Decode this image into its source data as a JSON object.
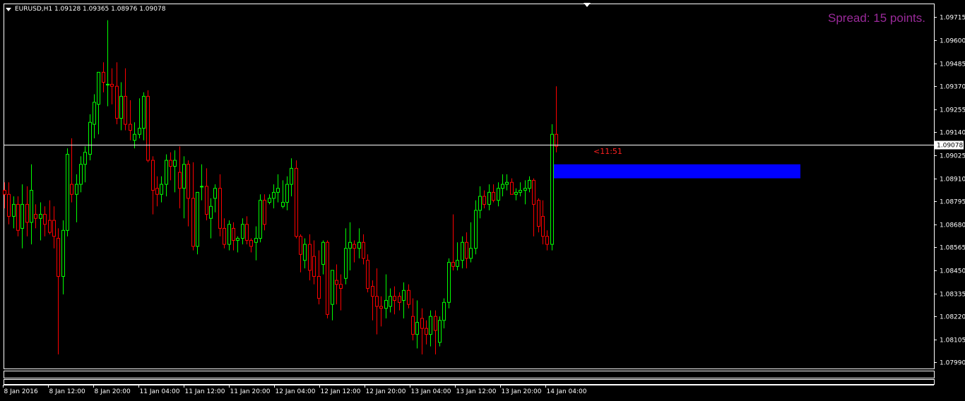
{
  "header": {
    "title": "EURUSD,H1  1.09128 1.09365 1.08976 1.09078",
    "spread": "Spread: 15 points.",
    "countdown": "<11:51"
  },
  "colors": {
    "background": "#000000",
    "bull": "#00ff00",
    "bear": "#ff0000",
    "grid_frame": "#ffffff",
    "axis_text": "#ffffff",
    "spread_text": "#9a2a9a",
    "zone": "#0000ff",
    "current_price_line": "#ffffff"
  },
  "chart_data": {
    "type": "candlestick",
    "symbol": "EURUSD",
    "timeframe": "H1",
    "ylim": [
      1.0794,
      1.0977
    ],
    "yticks": [
      "1.09715",
      "1.09600",
      "1.09485",
      "1.09370",
      "1.09255",
      "1.09140",
      "1.09025",
      "1.08910",
      "1.08795",
      "1.08680",
      "1.08565",
      "1.08450",
      "1.08335",
      "1.08220",
      "1.08105",
      "1.07990"
    ],
    "xticks": [
      "8 Jan 2016",
      "8 Jan 12:00",
      "8 Jan 20:00",
      "11 Jan 04:00",
      "11 Jan 12:00",
      "11 Jan 20:00",
      "12 Jan 04:00",
      "12 Jan 12:00",
      "12 Jan 20:00",
      "13 Jan 04:00",
      "13 Jan 12:00",
      "13 Jan 20:00",
      "14 Jan 04:00"
    ],
    "current_price": "1.09078",
    "zone": {
      "top": 1.0898,
      "bottom": 1.0891
    },
    "candles": [
      [
        1.0885,
        1.0889,
        1.0876,
        1.0883
      ],
      [
        1.0883,
        1.0889,
        1.0868,
        1.0872
      ],
      [
        1.0872,
        1.0882,
        1.0866,
        1.0878
      ],
      [
        1.0878,
        1.0882,
        1.0862,
        1.0865
      ],
      [
        1.0866,
        1.0888,
        1.0856,
        1.0878
      ],
      [
        1.0878,
        1.0887,
        1.0862,
        1.0869
      ],
      [
        1.0869,
        1.0898,
        1.0858,
        1.0885
      ],
      [
        1.0873,
        1.0878,
        1.0866,
        1.0871
      ],
      [
        1.0871,
        1.0879,
        1.086,
        1.0873
      ],
      [
        1.0873,
        1.0877,
        1.0862,
        1.0868
      ],
      [
        1.087,
        1.088,
        1.0863,
        1.0864
      ],
      [
        1.087,
        1.0877,
        1.0856,
        1.0862
      ],
      [
        1.0861,
        1.0866,
        1.0803,
        1.0842
      ],
      [
        1.0842,
        1.087,
        1.0833,
        1.0865
      ],
      [
        1.0865,
        1.0906,
        1.0862,
        1.0903
      ],
      [
        1.0888,
        1.0911,
        1.0879,
        1.0883
      ],
      [
        1.0883,
        1.0893,
        1.0869,
        1.0888
      ],
      [
        1.0888,
        1.0902,
        1.0884,
        1.0898
      ],
      [
        1.0898,
        1.0907,
        1.0889,
        1.0904
      ],
      [
        1.0903,
        1.0923,
        1.09,
        1.0919
      ],
      [
        1.0918,
        1.0933,
        1.0911,
        1.0929
      ],
      [
        1.0928,
        1.0943,
        1.0913,
        1.0944
      ],
      [
        1.0944,
        1.0949,
        1.0934,
        1.0939
      ],
      [
        1.0938,
        1.097,
        1.0927,
        1.0938
      ],
      [
        1.0938,
        1.0946,
        1.0928,
        1.0937
      ],
      [
        1.0937,
        1.0949,
        1.0918,
        1.0921
      ],
      [
        1.0921,
        1.0939,
        1.0915,
        1.0932
      ],
      [
        1.0932,
        1.0946,
        1.0915,
        1.0918
      ],
      [
        1.0918,
        1.093,
        1.091,
        1.0915
      ],
      [
        1.091,
        1.0919,
        1.0906,
        1.0913
      ],
      [
        1.0913,
        1.0931,
        1.0911,
        1.0916
      ],
      [
        1.0916,
        1.0934,
        1.091,
        1.0932
      ],
      [
        1.0932,
        1.0935,
        1.0899,
        1.09
      ],
      [
        1.09,
        1.0902,
        1.0873,
        1.0885
      ],
      [
        1.0886,
        1.0892,
        1.0877,
        1.0883
      ],
      [
        1.0883,
        1.0892,
        1.0879,
        1.0888
      ],
      [
        1.0888,
        1.0903,
        1.0882,
        1.09
      ],
      [
        1.09,
        1.0904,
        1.089,
        1.0897
      ],
      [
        1.0897,
        1.0905,
        1.0884,
        1.09
      ],
      [
        1.0894,
        1.0907,
        1.0876,
        1.0886
      ],
      [
        1.0886,
        1.0902,
        1.0871,
        1.0898
      ],
      [
        1.0898,
        1.09,
        1.0867,
        1.0881
      ],
      [
        1.0881,
        1.0899,
        1.0855,
        1.0857
      ],
      [
        1.0857,
        1.0884,
        1.0853,
        1.0884
      ],
      [
        1.0887,
        1.0898,
        1.088,
        1.0887
      ],
      [
        1.0887,
        1.0896,
        1.087,
        1.0873
      ],
      [
        1.0871,
        1.0881,
        1.0861,
        1.0877
      ],
      [
        1.0881,
        1.0888,
        1.0874,
        1.0886
      ],
      [
        1.0886,
        1.0893,
        1.0862,
        1.0866
      ],
      [
        1.0866,
        1.0871,
        1.0856,
        1.0858
      ],
      [
        1.0858,
        1.087,
        1.0855,
        1.0868
      ],
      [
        1.0866,
        1.0869,
        1.0855,
        1.086
      ],
      [
        1.086,
        1.0862,
        1.0854,
        1.0861
      ],
      [
        1.0861,
        1.0871,
        1.0858,
        1.0868
      ],
      [
        1.0868,
        1.0872,
        1.0858,
        1.086
      ],
      [
        1.086,
        1.0861,
        1.0854,
        1.0857
      ],
      [
        1.0859,
        1.0867,
        1.085,
        1.0861
      ],
      [
        1.0861,
        1.0883,
        1.0859,
        1.088
      ],
      [
        1.088,
        1.0883,
        1.0865,
        1.0868
      ],
      [
        1.0879,
        1.0883,
        1.0878,
        1.0881
      ],
      [
        1.0881,
        1.0888,
        1.0876,
        1.0884
      ],
      [
        1.0884,
        1.0893,
        1.0879,
        1.0886
      ],
      [
        1.0877,
        1.089,
        1.0876,
        1.0879
      ],
      [
        1.0879,
        1.0892,
        1.0875,
        1.0888
      ],
      [
        1.0888,
        1.0901,
        1.0882,
        1.0896
      ],
      [
        1.0896,
        1.09,
        1.0861,
        1.0862
      ],
      [
        1.0862,
        1.0863,
        1.0844,
        1.0853
      ],
      [
        1.085,
        1.0861,
        1.0846,
        1.0858
      ],
      [
        1.0858,
        1.0863,
        1.084,
        1.0845
      ],
      [
        1.0852,
        1.086,
        1.0838,
        1.0842
      ],
      [
        1.0842,
        1.0855,
        1.0828,
        1.0831
      ],
      [
        1.0848,
        1.086,
        1.0843,
        1.0859
      ],
      [
        1.0859,
        1.086,
        1.0821,
        1.0823
      ],
      [
        1.0828,
        1.0841,
        1.082,
        1.0845
      ],
      [
        1.084,
        1.0848,
        1.0828,
        1.0838
      ],
      [
        1.0838,
        1.0843,
        1.0825,
        1.0836
      ],
      [
        1.0841,
        1.0866,
        1.0838,
        1.0856
      ],
      [
        1.0856,
        1.0869,
        1.0845,
        1.0859
      ],
      [
        1.0858,
        1.086,
        1.0849,
        1.0856
      ],
      [
        1.0856,
        1.0866,
        1.0851,
        1.0859
      ],
      [
        1.0859,
        1.0863,
        1.0848,
        1.0851
      ],
      [
        1.085,
        1.0853,
        1.0834,
        1.0836
      ],
      [
        1.0837,
        1.084,
        1.082,
        1.0832
      ],
      [
        1.0832,
        1.0846,
        1.0813,
        1.0827
      ],
      [
        1.0827,
        1.0832,
        1.0817,
        1.0826
      ],
      [
        1.0826,
        1.0843,
        1.0821,
        1.083
      ],
      [
        1.0827,
        1.0836,
        1.0824,
        1.0832
      ],
      [
        1.0832,
        1.0837,
        1.0823,
        1.083
      ],
      [
        1.0832,
        1.0834,
        1.0825,
        1.0829
      ],
      [
        1.083,
        1.0839,
        1.0821,
        1.0835
      ],
      [
        1.0835,
        1.0838,
        1.0826,
        1.0828
      ],
      [
        1.0822,
        1.0831,
        1.081,
        1.0813
      ],
      [
        1.0813,
        1.083,
        1.0806,
        1.0819
      ],
      [
        1.0821,
        1.0826,
        1.0803,
        1.0816
      ],
      [
        1.0816,
        1.082,
        1.0808,
        1.0813
      ],
      [
        1.0813,
        1.0825,
        1.0807,
        1.0822
      ],
      [
        1.0822,
        1.0825,
        1.0803,
        1.0815
      ],
      [
        1.0809,
        1.0822,
        1.0807,
        1.082
      ],
      [
        1.082,
        1.0831,
        1.0816,
        1.0829
      ],
      [
        1.0829,
        1.0851,
        1.0826,
        1.0849
      ],
      [
        1.0849,
        1.0873,
        1.0845,
        1.0847
      ],
      [
        1.0847,
        1.0859,
        1.0845,
        1.085
      ],
      [
        1.085,
        1.0862,
        1.0846,
        1.0859
      ],
      [
        1.0859,
        1.0864,
        1.0846,
        1.0851
      ],
      [
        1.0851,
        1.0869,
        1.0849,
        1.0856
      ],
      [
        1.0856,
        1.088,
        1.0853,
        1.0875
      ],
      [
        1.0875,
        1.0887,
        1.0871,
        1.0882
      ],
      [
        1.0882,
        1.0885,
        1.0876,
        1.0878
      ],
      [
        1.0878,
        1.0888,
        1.0875,
        1.0884
      ],
      [
        1.0884,
        1.0888,
        1.0879,
        1.088
      ],
      [
        1.088,
        1.0889,
        1.0877,
        1.0886
      ],
      [
        1.0886,
        1.0893,
        1.0882,
        1.0888
      ],
      [
        1.0888,
        1.0893,
        1.0885,
        1.0889
      ],
      [
        1.0889,
        1.0891,
        1.0883,
        1.0883
      ],
      [
        1.0883,
        1.0886,
        1.088,
        1.0884
      ],
      [
        1.0884,
        1.0889,
        1.0882,
        1.0885
      ],
      [
        1.0885,
        1.089,
        1.0878,
        1.0886
      ],
      [
        1.0886,
        1.0892,
        1.0884,
        1.089
      ],
      [
        1.089,
        1.0891,
        1.0862,
        1.0878
      ],
      [
        1.088,
        1.0881,
        1.0864,
        1.0867
      ],
      [
        1.0872,
        1.088,
        1.0858,
        1.0862
      ],
      [
        1.0862,
        1.0865,
        1.0855,
        1.0858
      ],
      [
        1.0858,
        1.0918,
        1.0855,
        1.0913
      ],
      [
        1.0913,
        1.0937,
        1.0904,
        1.0907
      ]
    ]
  }
}
